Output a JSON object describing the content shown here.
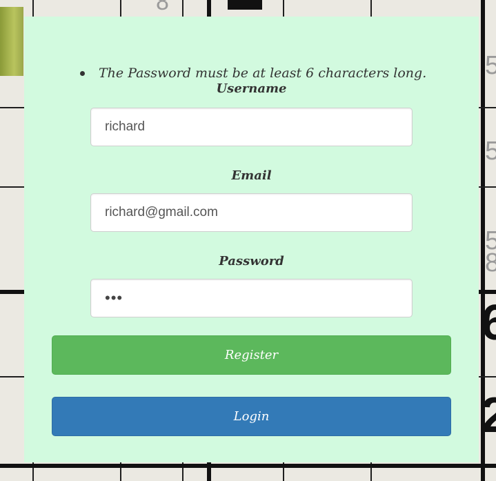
{
  "notice": {
    "items": [
      "The Password must be at least 6 characters long."
    ]
  },
  "form": {
    "username": {
      "label": "Username",
      "value": "richard"
    },
    "email": {
      "label": "Email",
      "value": "richard@gmail.com"
    },
    "password": {
      "label": "Password",
      "value": "•••"
    }
  },
  "buttons": {
    "register_label": "Register",
    "login_label": "Login"
  },
  "colors": {
    "card_background": "#d2fadf",
    "register_button": "#5cb85c",
    "login_button": "#337ab7"
  },
  "background": {
    "digits": [
      "8",
      "5",
      "5",
      "5",
      "8",
      "6",
      "2"
    ]
  }
}
